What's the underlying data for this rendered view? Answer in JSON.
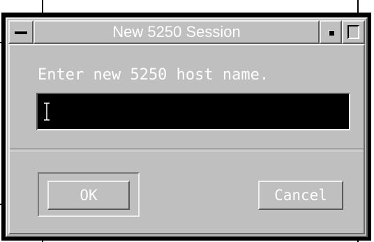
{
  "window": {
    "title": "New 5250 Session"
  },
  "dialog": {
    "prompt": "Enter new 5250 host name.",
    "host_input": {
      "value": "",
      "placeholder": ""
    },
    "ok_label": "OK",
    "cancel_label": "Cancel"
  },
  "icons": {
    "window_menu": "window-menu-icon",
    "minimize": "minimize-icon",
    "maximize": "maximize-icon",
    "text_cursor": "ibeam-cursor-icon"
  },
  "colors": {
    "panel": "#bfbfbf",
    "field_background": "#000000",
    "label_text": "#ffffff"
  }
}
